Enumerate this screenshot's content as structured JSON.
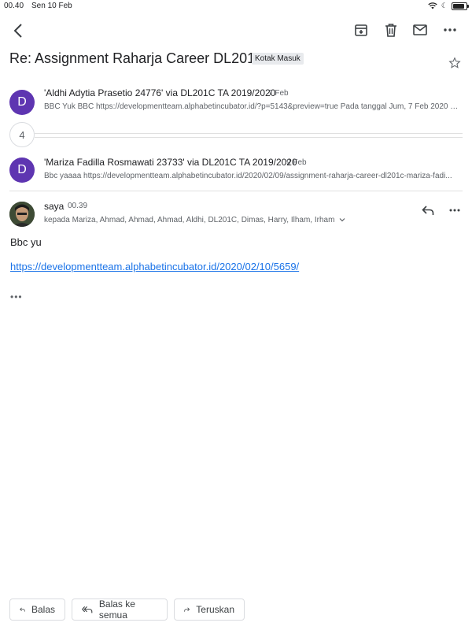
{
  "status_bar": {
    "time": "00.40",
    "date": "Sen 10 Feb"
  },
  "toolbar": {
    "back_icon": "chevron-left-icon",
    "archive_icon": "archive-icon",
    "delete_icon": "trash-icon",
    "unread_icon": "mail-icon",
    "more_icon": "more-horizontal-icon"
  },
  "thread": {
    "subject": "Re: Assignment Raharja Career DL201C",
    "label": "Kotak Masuk"
  },
  "messages": [
    {
      "avatar_letter": "D",
      "sender": "'Aldhi Adytia Prasetio 24776' via DL201C TA 2019/2020",
      "date": "7 Feb",
      "snippet": "BBC Yuk BBC https://developmentteam.alphabetincubator.id/?p=5143&preview=true Pada tanggal Jum, 7 Feb 2020 1..."
    },
    {
      "avatar_letter": "D",
      "sender": "'Mariza Fadilla Rosmawati 23733' via DL201C TA 2019/2020",
      "date": "9 Feb",
      "snippet": "Bbc yaaaa https://developmentteam.alphabetincubator.id/2020/02/09/assignment-raharja-career-dl201c-mariza-fadi..."
    }
  ],
  "collapsed_count": "4",
  "open_message": {
    "sender": "saya",
    "time": "00.39",
    "recipients": "kepada Mariza, Ahmad, Ahmad, Ahmad, Aldhi, DL201C, Dimas, Harry, Ilham, Irham",
    "body": "Bbc yu",
    "link": "https://developmentteam.alphabetincubator.id/2020/02/10/5659/",
    "trimmed": "•••"
  },
  "actions": {
    "reply": "Balas",
    "reply_all": "Balas ke semua",
    "forward": "Teruskan"
  },
  "colors": {
    "avatar": "#5e35b1",
    "link": "#1a73e8"
  }
}
